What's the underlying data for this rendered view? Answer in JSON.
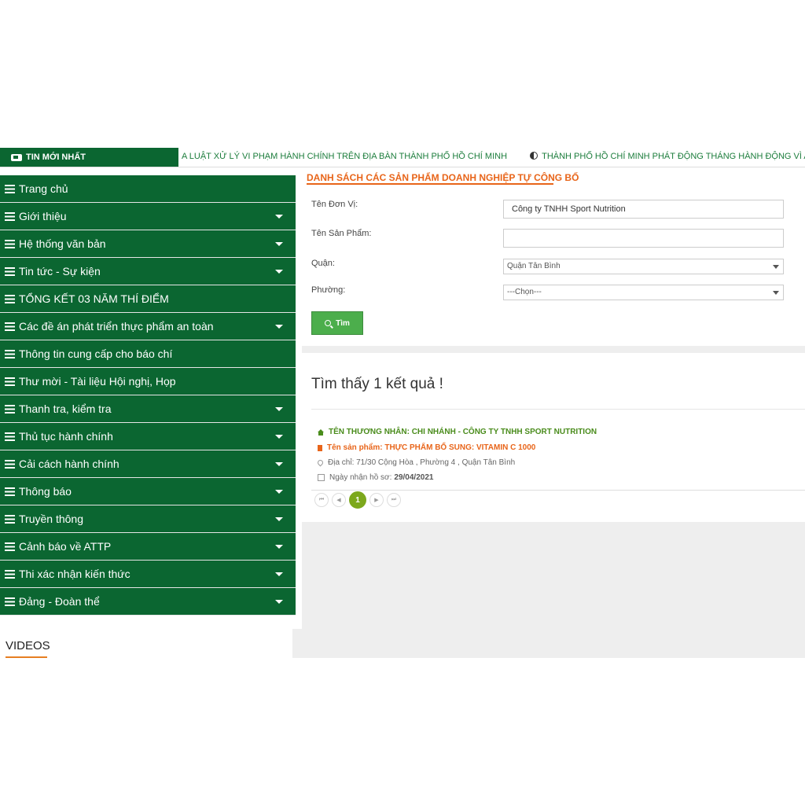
{
  "ticker": {
    "label": "TIN MỚI NHẤT",
    "items": [
      "A LUẬT XỬ LÝ VI PHẠM HÀNH CHÍNH TRÊN ĐỊA BÀN THÀNH PHỐ HỒ CHÍ MINH",
      "THÀNH PHỐ HỒ CHÍ MINH PHÁT ĐỘNG THÁNG HÀNH ĐỘNG VÌ AN TOÀN THỰC PHẨ"
    ]
  },
  "sidebar": {
    "items": [
      {
        "label": "Trang chủ",
        "dropdown": false
      },
      {
        "label": "Giới thiệu",
        "dropdown": true
      },
      {
        "label": "Hệ thống văn bản",
        "dropdown": true
      },
      {
        "label": "Tin tức - Sự kiện",
        "dropdown": true
      },
      {
        "label": "TỔNG KẾT 03 NĂM THÍ ĐIỂM",
        "dropdown": false
      },
      {
        "label": "Các đề án phát triển thực phẩm an toàn",
        "dropdown": true
      },
      {
        "label": "Thông tin cung cấp cho báo chí",
        "dropdown": false
      },
      {
        "label": "Thư mời - Tài liệu Hội nghị, Họp",
        "dropdown": false
      },
      {
        "label": "Thanh tra, kiểm tra",
        "dropdown": true
      },
      {
        "label": "Thủ tục hành chính",
        "dropdown": true
      },
      {
        "label": "Cải cách hành chính",
        "dropdown": true
      },
      {
        "label": "Thông báo",
        "dropdown": true
      },
      {
        "label": "Truyền thông",
        "dropdown": true
      },
      {
        "label": "Cảnh báo về ATTP",
        "dropdown": true
      },
      {
        "label": "Thi xác nhận kiến thức",
        "dropdown": true
      },
      {
        "label": "Đảng - Đoàn thể",
        "dropdown": true
      }
    ],
    "videos_title": "VIDEOS"
  },
  "main": {
    "section_title": "DANH SÁCH CÁC SẢN PHẨM DOANH NGHIỆP TỰ CÔNG BỐ",
    "form": {
      "unit_label": "Tên Đơn Vị:",
      "unit_value": "Công ty TNHH Sport Nutrition",
      "product_label": "Tên Sản Phẩm:",
      "product_value": "",
      "district_label": "Quận:",
      "district_value": "Quận Tân Bình",
      "ward_label": "Phường:",
      "ward_value": "---Chọn---",
      "search_label": "Tìm"
    },
    "results": {
      "count_text": "Tìm thấy 1 kết quả !",
      "merchant": "TÊN THƯƠNG NHÂN: CHI NHÁNH - CÔNG TY TNHH SPORT NUTRITION",
      "product": "Tên sản phẩm: THỰC PHẨM BỔ SUNG: VITAMIN C 1000",
      "address": "Địa chỉ: 71/30 Cộng Hòa , Phường 4 , Quận Tân Bình",
      "date_label": "Ngày nhận hồ sơ:",
      "date_value": "29/04/2021"
    },
    "pager": {
      "first": "⏮",
      "prev": "◀",
      "current": "1",
      "next": "▶",
      "last": "⏭"
    }
  },
  "colors": {
    "brand_green": "#0b6631",
    "accent_orange": "#e8651a",
    "button_green": "#4cae4c",
    "pager_active": "#7ca81c"
  }
}
